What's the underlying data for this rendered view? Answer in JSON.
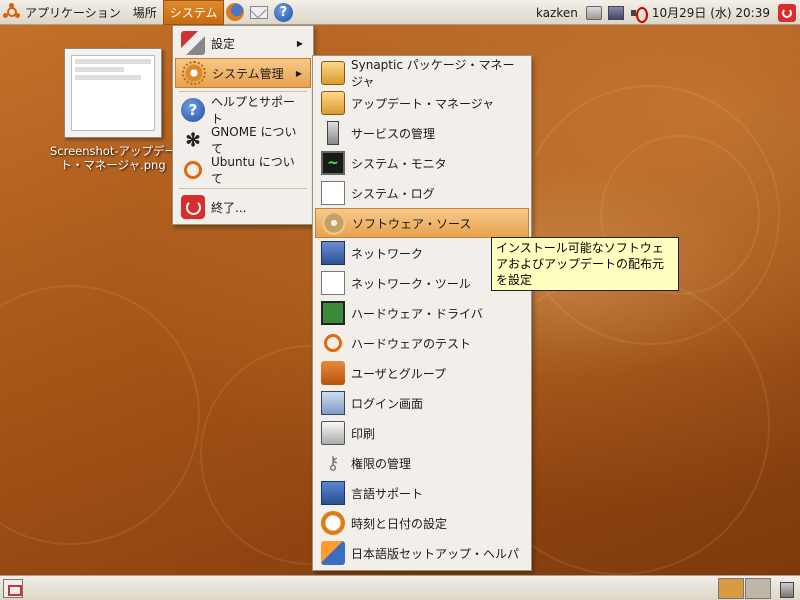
{
  "top_panel": {
    "applications": "アプリケーション",
    "places": "場所",
    "system": "システム",
    "username": "kazken",
    "datetime": "10月29日 (水) 20:39"
  },
  "desktop": {
    "file_label": "Screenshot-アップデート・マネージャ.png"
  },
  "system_menu": {
    "items": [
      {
        "label": "設定",
        "icon": "preferences-icon",
        "submenu": true
      },
      {
        "label": "システム管理",
        "icon": "system-admin-icon",
        "submenu": true
      },
      {
        "label": "ヘルプとサポート",
        "icon": "help-icon"
      },
      {
        "label": "GNOME について",
        "icon": "gnome-icon"
      },
      {
        "label": "Ubuntu について",
        "icon": "ubuntu-icon"
      },
      {
        "label": "終了...",
        "icon": "shutdown-icon"
      }
    ]
  },
  "admin_menu": {
    "items": [
      {
        "label": "Synaptic パッケージ・マネージャ",
        "icon": "synaptic-icon"
      },
      {
        "label": "アップデート・マネージャ",
        "icon": "update-manager-icon"
      },
      {
        "label": "サービスの管理",
        "icon": "services-icon"
      },
      {
        "label": "システム・モニタ",
        "icon": "system-monitor-icon"
      },
      {
        "label": "システム・ログ",
        "icon": "system-log-icon"
      },
      {
        "label": "ソフトウェア・ソース",
        "icon": "software-sources-icon"
      },
      {
        "label": "ネットワーク",
        "icon": "network-icon"
      },
      {
        "label": "ネットワーク・ツール",
        "icon": "network-tools-icon"
      },
      {
        "label": "ハードウェア・ドライバ",
        "icon": "hardware-drivers-icon"
      },
      {
        "label": "ハードウェアのテスト",
        "icon": "hardware-test-icon"
      },
      {
        "label": "ユーザとグループ",
        "icon": "users-groups-icon"
      },
      {
        "label": "ログイン画面",
        "icon": "login-screen-icon"
      },
      {
        "label": "印刷",
        "icon": "printer-icon"
      },
      {
        "label": "権限の管理",
        "icon": "authorizations-icon"
      },
      {
        "label": "言語サポート",
        "icon": "language-support-icon"
      },
      {
        "label": "時刻と日付の設定",
        "icon": "time-date-icon"
      },
      {
        "label": "日本語版セットアップ・ヘルパ",
        "icon": "japanese-setup-icon"
      }
    ]
  },
  "tooltip": {
    "text": "インストール可能なソフトウェアおよびアップデートの配布元を設定"
  },
  "colors": {
    "highlight": "#e8a24e",
    "panel": "#ddd6c8",
    "desktop": "#a85718"
  }
}
